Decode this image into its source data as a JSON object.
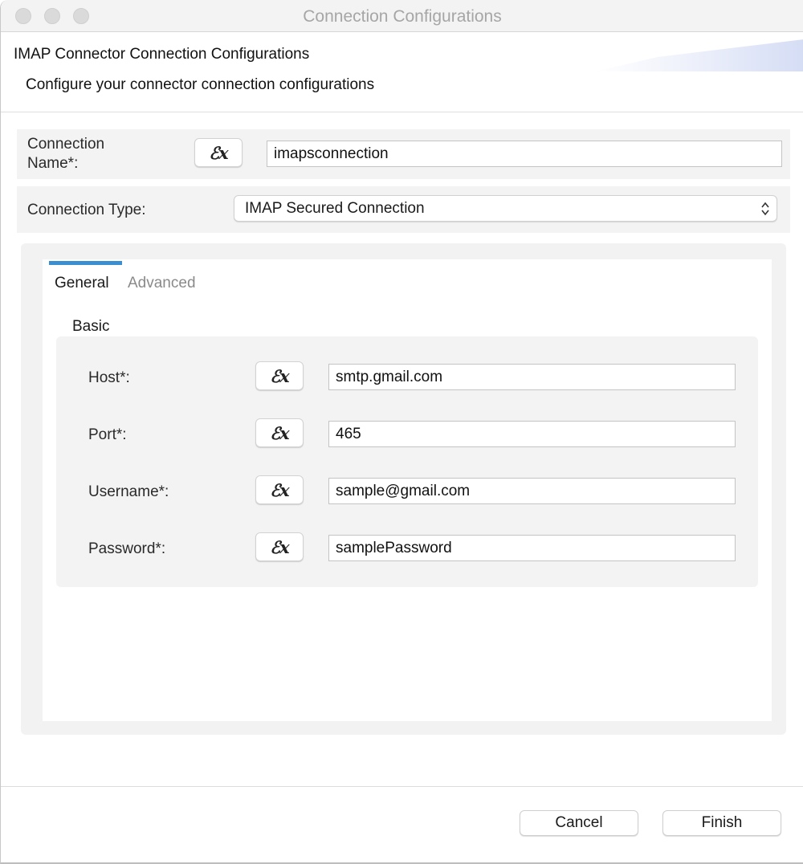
{
  "window": {
    "title": "Connection Configurations"
  },
  "banner": {
    "title": "IMAP Connector Connection Configurations",
    "description": "Configure your connector connection configurations"
  },
  "connection_name": {
    "label": "Connection Name*:",
    "expression_button": "ℰx",
    "value": "imapsconnection"
  },
  "connection_type": {
    "label": "Connection Type:",
    "selected": "IMAP Secured Connection"
  },
  "tabs": [
    {
      "label": "General",
      "active": true
    },
    {
      "label": "Advanced",
      "active": false
    }
  ],
  "basic_group": {
    "label": "Basic",
    "fields": [
      {
        "label": "Host*:",
        "expression_button": "ℰx",
        "value": "smtp.gmail.com"
      },
      {
        "label": "Port*:",
        "expression_button": "ℰx",
        "value": "465"
      },
      {
        "label": "Username*:",
        "expression_button": "ℰx",
        "value": "sample@gmail.com"
      },
      {
        "label": "Password*:",
        "expression_button": "ℰx",
        "value": "samplePassword"
      }
    ]
  },
  "footer": {
    "cancel_label": "Cancel",
    "finish_label": "Finish"
  },
  "colors": {
    "tab_accent": "#3b8fd0",
    "panel_bg": "#f3f3f3"
  }
}
